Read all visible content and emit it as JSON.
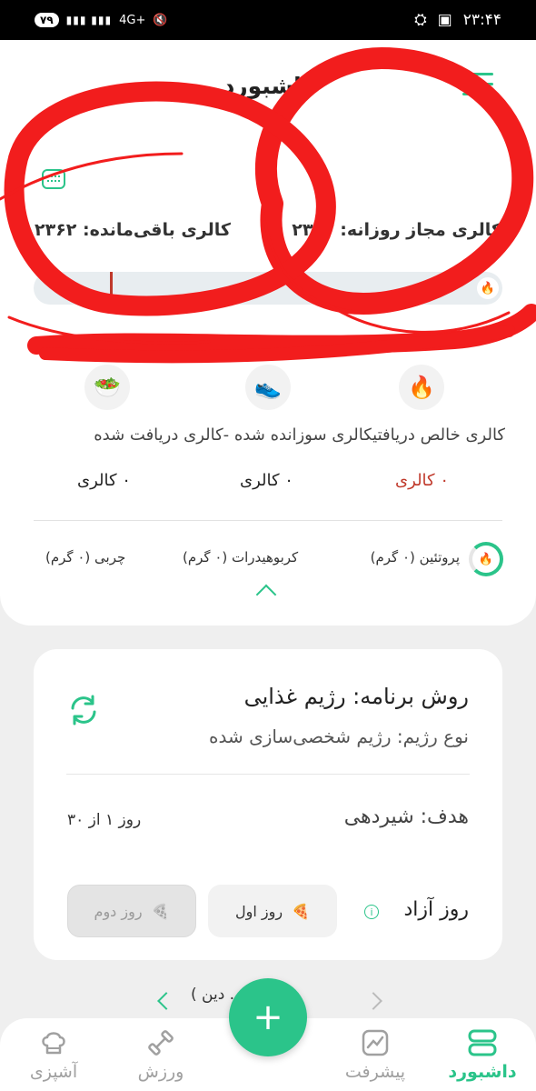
{
  "status_bar": {
    "time": "۲۳:۴۴",
    "battery": "۷۹",
    "network": "4G+"
  },
  "header": {
    "title": "داشبورد"
  },
  "calories": {
    "daily_allowed": "کالری مجاز روزانه: ۲۳۶۲",
    "remaining": "کالری باقی‌مانده: ۲۳۶۲",
    "progress": 0.0
  },
  "stats": {
    "labels": "کالری خالص دریافتیکالری سوزانده شده -کالری دریافت شده",
    "received": "۰ کالری",
    "burned": "۰ کالری",
    "net": "۰ کالری",
    "received_color": "#c0392b"
  },
  "macros": {
    "protein": "پروتئین (۰ گرم)",
    "carbs": "کربوهیدرات (۰ گرم)",
    "fat": "چربی (۰ گرم)"
  },
  "plan": {
    "method": "روش برنامه: رژیم غذایی",
    "type": "نوع رژیم: رژیم شخصی‌سازی شده",
    "goal": "هدف: شیردهی",
    "day": "روز ۱ از ۳۰",
    "free_day_label": "روز آزاد",
    "first_day": "روز اول",
    "second_day": "روز دوم"
  },
  "date_nav": {
    "text": "امروز (... دین )"
  },
  "bottom_nav": {
    "dashboard": "داشبورد",
    "progress": "پیشرفت",
    "exercise": "ورزش",
    "cooking": "آشپزی"
  },
  "colors": {
    "accent": "#2bc48a",
    "scribble": "#f21d1d"
  }
}
